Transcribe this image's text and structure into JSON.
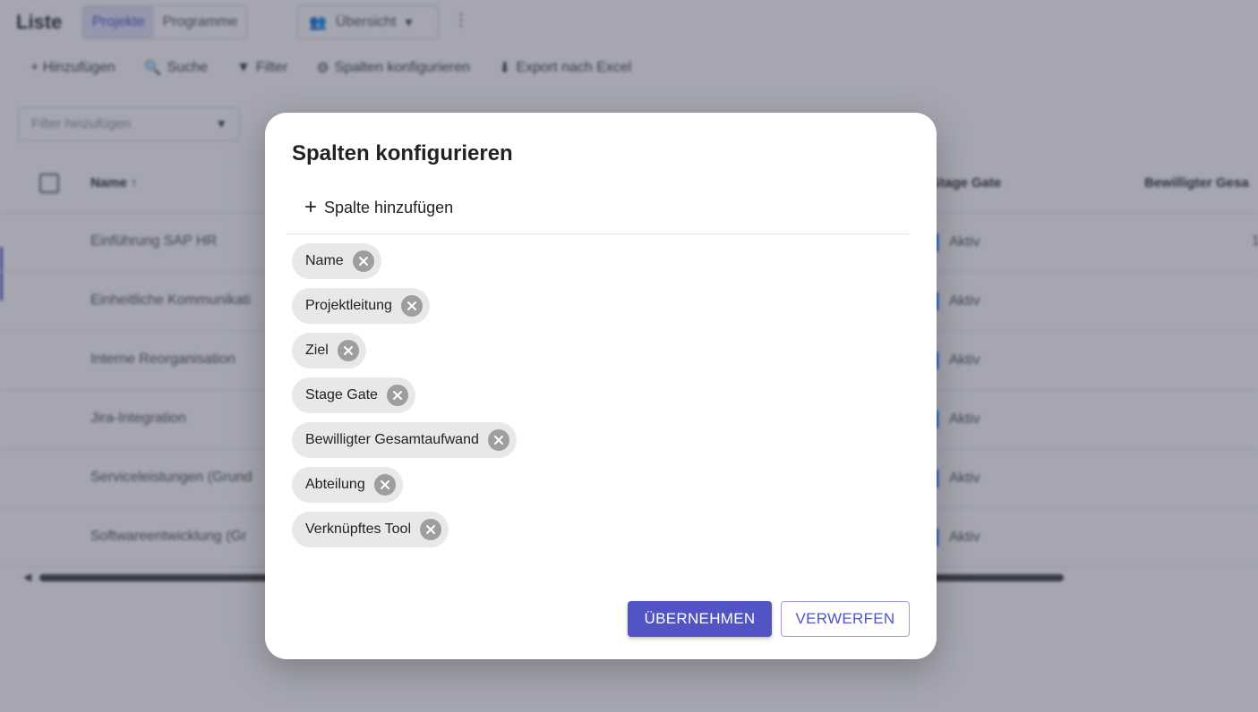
{
  "app": {
    "title": "Liste",
    "segments": [
      "Projekte",
      "Programme"
    ],
    "active_segment": "Projekte",
    "view_select": "Übersicht",
    "kebab": "⋮"
  },
  "toolbar": {
    "add": "+ Hinzufügen",
    "search": "Suche",
    "filter": "Filter",
    "columns": "Spalten konfigurieren",
    "export": "Export nach Excel"
  },
  "filter_box": {
    "placeholder": "Filter hinzufügen"
  },
  "table": {
    "headers": {
      "name": "Name ↑",
      "stage_gate": "Stage Gate",
      "bewilligt": "Bewilligter Gesa"
    },
    "rows": [
      {
        "name": "Einführung SAP HR",
        "stage": "Aktiv",
        "value": "1"
      },
      {
        "name": "Einheitliche Kommunikati",
        "stage": "Aktiv",
        "value": ""
      },
      {
        "name": "Interne Reorganisation",
        "stage": "Aktiv",
        "value": ""
      },
      {
        "name": "Jira-Integration",
        "stage": "Aktiv",
        "value": ""
      },
      {
        "name": "Serviceleistungen (Grund",
        "stage": "Aktiv",
        "value": ""
      },
      {
        "name": "Softwareentwicklung (Gr",
        "stage": "Aktiv",
        "value": ""
      }
    ]
  },
  "dialog": {
    "title": "Spalten konfigurieren",
    "add_column": "Spalte hinzufügen",
    "chips": [
      "Name",
      "Projektleitung",
      "Ziel",
      "Stage Gate",
      "Bewilligter Gesamtaufwand",
      "Abteilung",
      "Verknüpftes Tool"
    ],
    "apply": "ÜBERNEHMEN",
    "discard": "VERWERFEN"
  },
  "colors": {
    "primary": "#5253c4",
    "chip_bg": "#e8e8e8",
    "chip_close": "#9e9e9e",
    "scrim": "rgba(40,42,68,0.42)"
  }
}
